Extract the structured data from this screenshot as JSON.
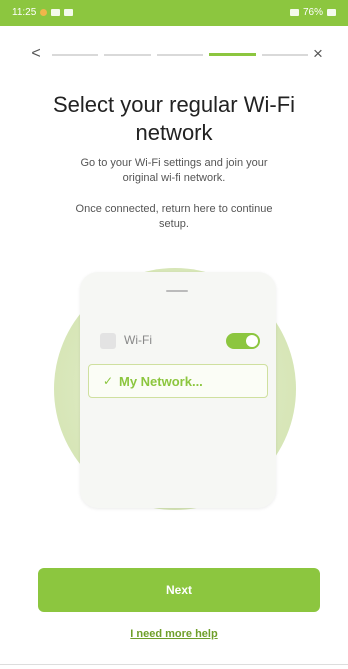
{
  "status_bar": {
    "time": "11:25",
    "battery": "76%"
  },
  "nav": {
    "back_icon": "chevron-left-icon",
    "close_icon": "close-icon",
    "back_glyph": "<",
    "close_glyph": "×",
    "progress_steps": 5,
    "active_step": 4
  },
  "title": "Select your regular Wi-Fi network",
  "instructions": {
    "line1": "Go to your Wi-Fi settings and join your original wi-fi network.",
    "line2": "Once connected, return here to continue setup."
  },
  "illustration": {
    "wifi_label": "Wi-Fi",
    "toggle_on": true,
    "network_name": "My Network...",
    "check_glyph": "✓"
  },
  "actions": {
    "next_label": "Next",
    "help_label": "I need more help"
  },
  "colors": {
    "accent": "#8cc63f",
    "accent_dark": "#6f9f2a"
  }
}
